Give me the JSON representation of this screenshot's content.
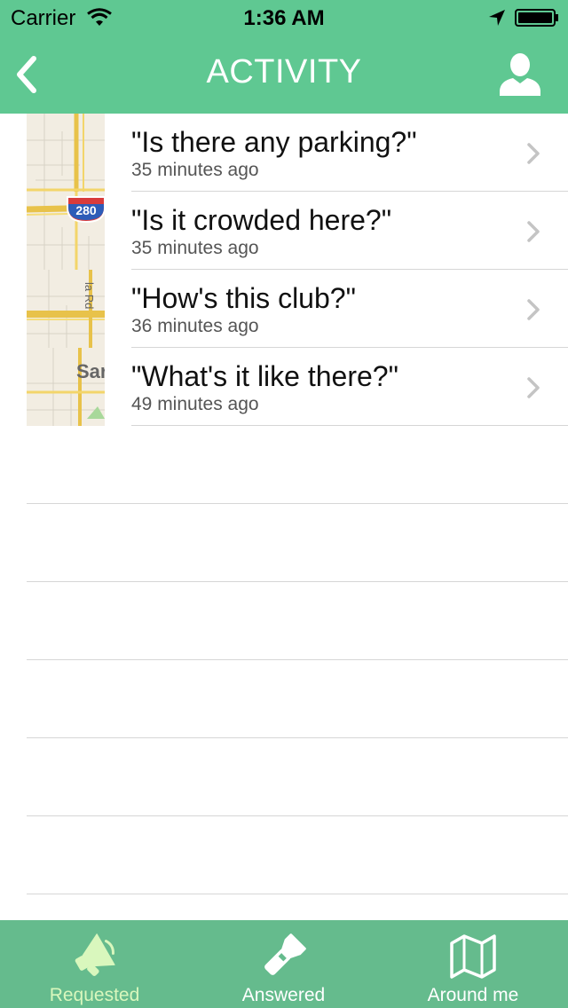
{
  "status_bar": {
    "carrier": "Carrier",
    "time": "1:36 AM"
  },
  "nav": {
    "title": "ACTIVITY",
    "back_icon": "chevron-left-icon",
    "profile_icon": "person-icon"
  },
  "activity": [
    {
      "title": "\"Is there any parking?\"",
      "time_ago": "35 minutes ago"
    },
    {
      "title": "\"Is it crowded here?\"",
      "time_ago": "35 minutes ago",
      "map_label": "280"
    },
    {
      "title": "\"How's this club?\"",
      "time_ago": "36 minutes ago",
      "map_label": "la Rd"
    },
    {
      "title": "\"What's it like there?\"",
      "time_ago": "49 minutes ago",
      "map_label": "Sar"
    }
  ],
  "tabs": [
    {
      "label": "Requested",
      "icon": "megaphone-icon",
      "active": true
    },
    {
      "label": "Answered",
      "icon": "flashlight-icon",
      "active": false
    },
    {
      "label": "Around me",
      "icon": "map-icon",
      "active": false
    }
  ],
  "colors": {
    "header": "#5fc892",
    "tabbar": "#65bb8d",
    "active_tab": "#d9f7bd"
  }
}
